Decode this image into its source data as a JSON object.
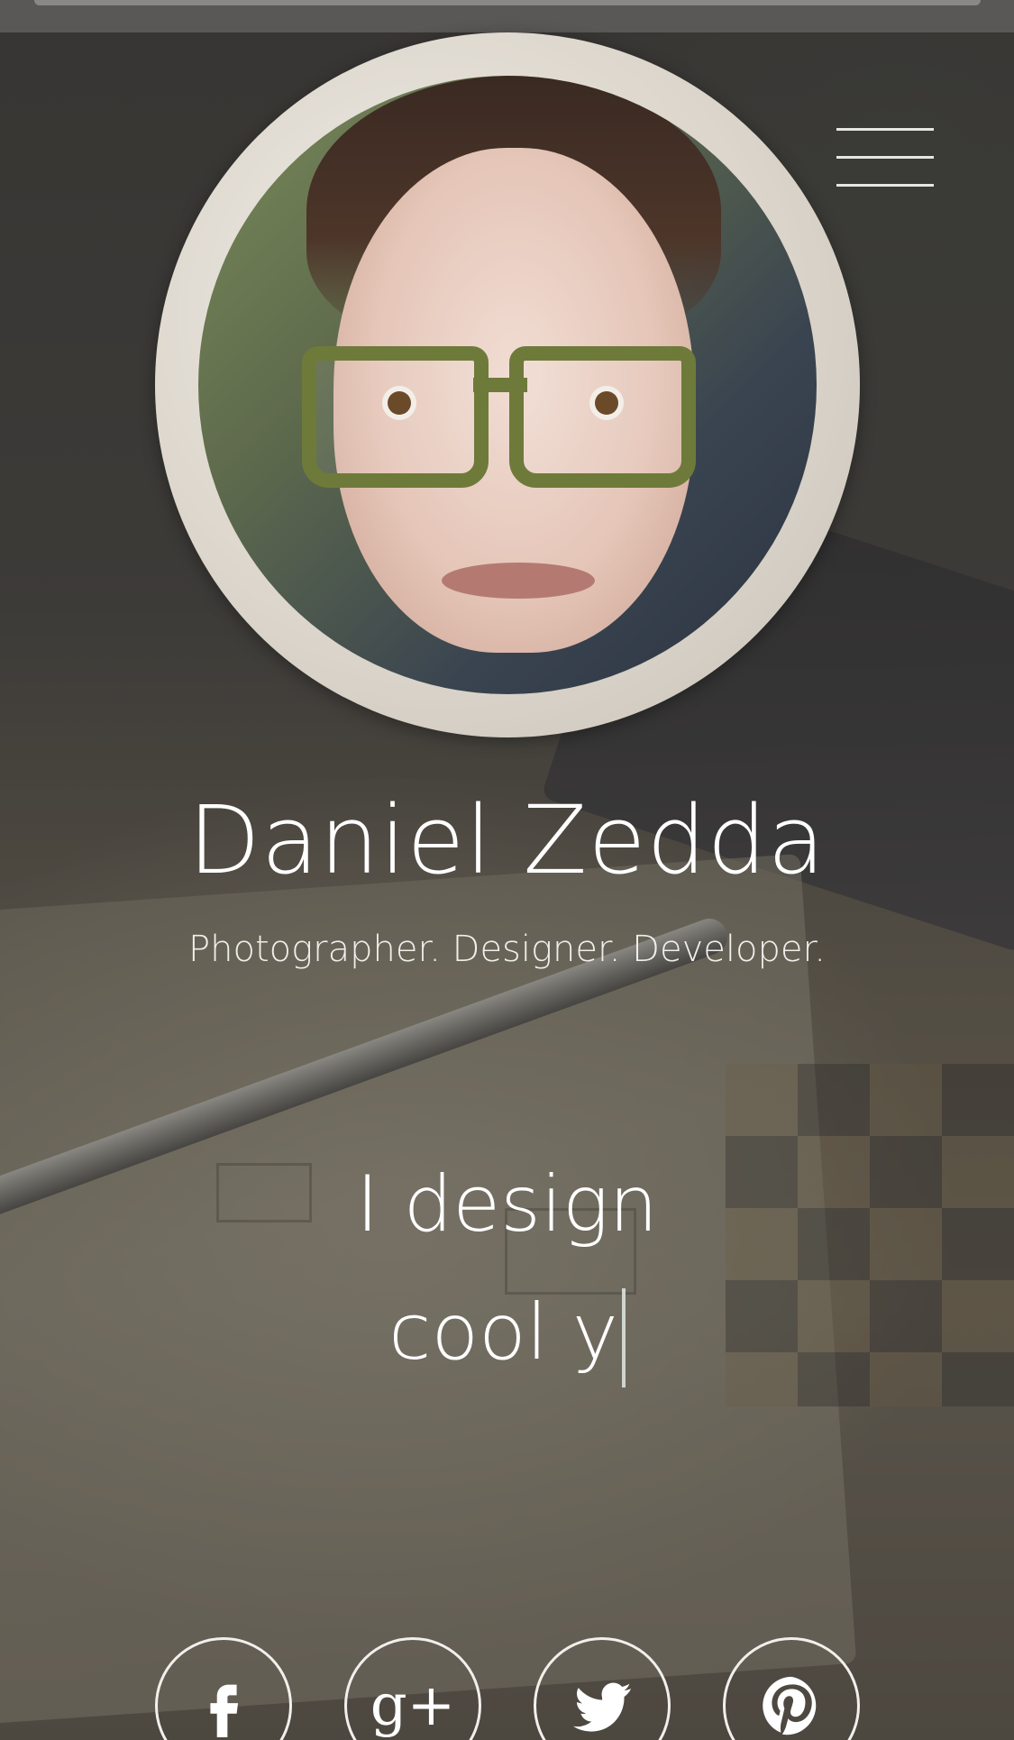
{
  "profile": {
    "name": "Daniel Zedda",
    "tagline": "Photographer. Designer. Developer."
  },
  "typing": {
    "line1": "I design",
    "line2": "cool y"
  },
  "menu": {
    "icon": "hamburger-menu-icon"
  },
  "social": [
    {
      "icon": "facebook-icon"
    },
    {
      "icon": "google-plus-icon",
      "glyph": "g+"
    },
    {
      "icon": "twitter-icon"
    },
    {
      "icon": "pinterest-icon"
    }
  ],
  "colors": {
    "text": "#ffffff",
    "ring": "#dcd6cc",
    "overlay": "#323030"
  }
}
